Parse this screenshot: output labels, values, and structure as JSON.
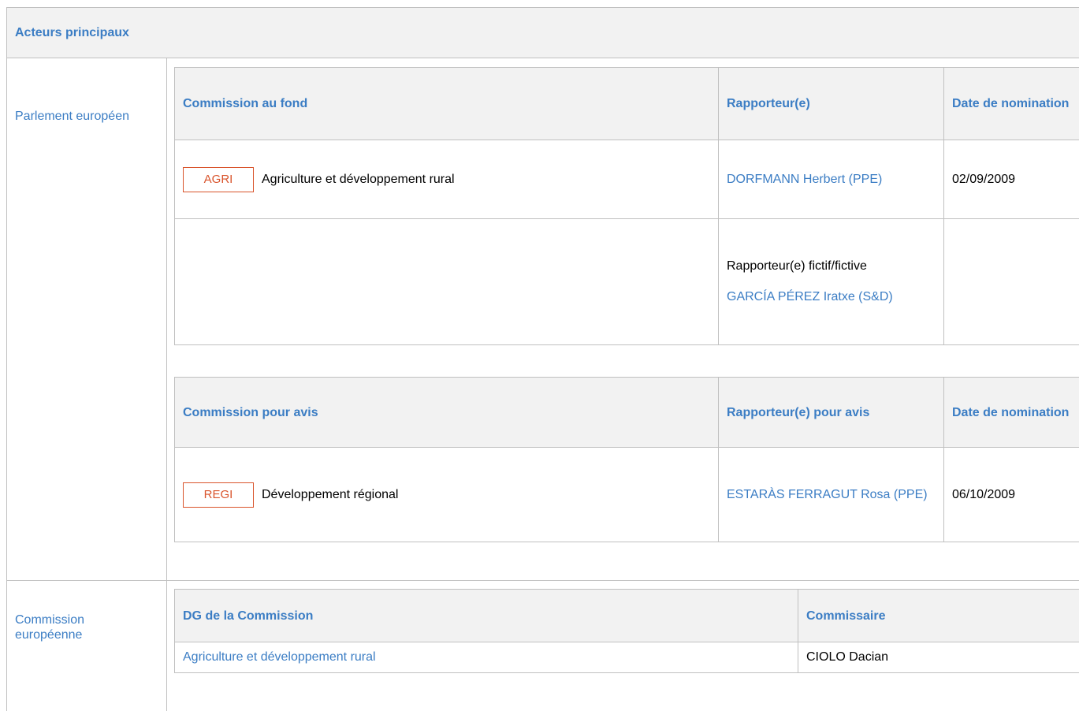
{
  "header": {
    "title": "Acteurs principaux"
  },
  "parlement": {
    "label": "Parlement européen",
    "fond_table": {
      "headers": {
        "commission": "Commission au fond",
        "rapporteur": "Rapporteur(e)",
        "date": "Date de nomination"
      },
      "row1": {
        "badge": "AGRI",
        "commission": "Agriculture et développement rural",
        "rapporteur": "DORFMANN Herbert (PPE)",
        "date": "02/09/2009"
      },
      "row2": {
        "shadow_label": "Rapporteur(e) fictif/fictive",
        "shadow_name": "GARCÍA PÉREZ Iratxe (S&D)"
      }
    },
    "avis_table": {
      "headers": {
        "commission": "Commission pour avis",
        "rapporteur": "Rapporteur(e) pour avis",
        "date": "Date de nomination"
      },
      "row1": {
        "badge": "REGI",
        "commission": "Développement régional",
        "rapporteur": "ESTARÀS FERRAGUT Rosa (PPE)",
        "date": "06/10/2009"
      }
    }
  },
  "commission": {
    "label": "Commission européenne",
    "table": {
      "headers": {
        "dg": "DG de la Commission",
        "commissaire": "Commissaire"
      },
      "row1": {
        "dg": "Agriculture et développement rural",
        "commissaire": "CIOLO Dacian"
      }
    }
  }
}
